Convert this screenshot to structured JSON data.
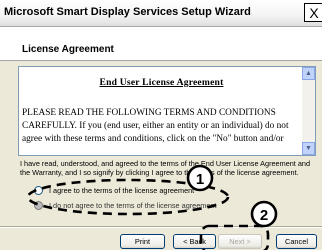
{
  "window": {
    "title": "Microsoft Smart Display Services Setup Wizard",
    "close_glyph": "X"
  },
  "header": {
    "title": "License Agreement"
  },
  "license": {
    "heading": "End User License Agreement",
    "body": "PLEASE READ THE FOLLOWING TERMS AND CONDITIONS CAREFULLY. If you (end user, either an entity or an individual) do not agree with these terms and conditions, click on the \"No\" button and/or"
  },
  "agreement_text": "I have read, understood, and agreed to the terms of the End User License Agreement and the Warranty, and I so signify by clicking I agree to the terms of the license agreement.",
  "radios": [
    {
      "label": "I agree to the terms of the license agreement"
    },
    {
      "label": "I do not agree to the terms of the license agreement"
    }
  ],
  "buttons": {
    "print": "Print",
    "back": "< Back",
    "next": "Next >",
    "cancel": "Cancel"
  },
  "callouts": {
    "one": "1",
    "two": "2"
  }
}
